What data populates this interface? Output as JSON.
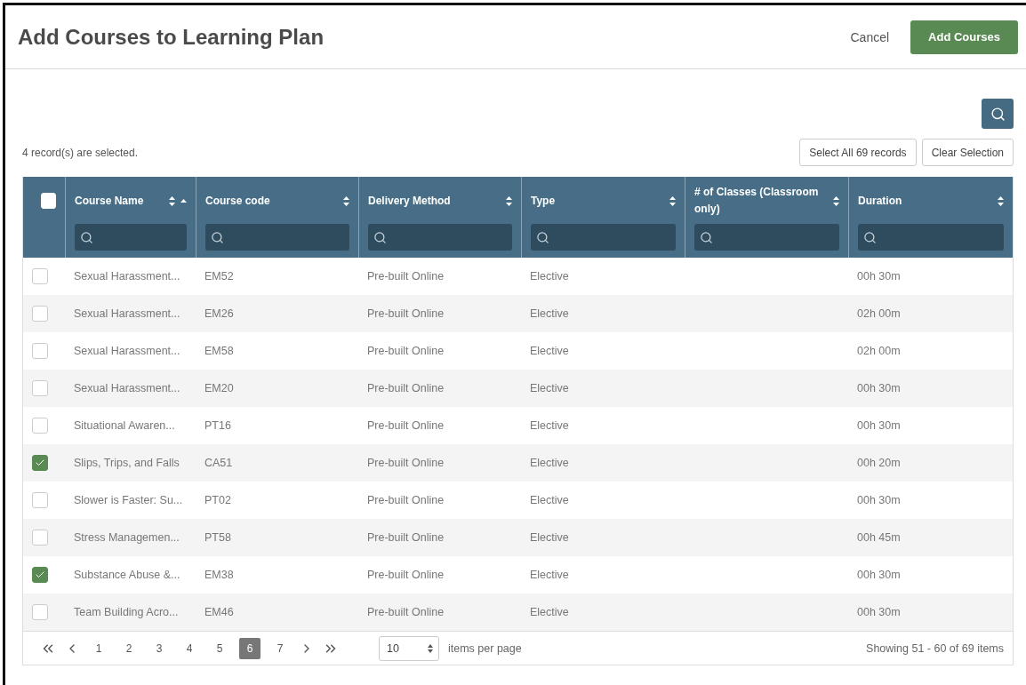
{
  "header": {
    "title": "Add Courses to Learning Plan",
    "cancel": "Cancel",
    "submit": "Add Courses"
  },
  "selection": {
    "summary": "4 record(s) are selected.",
    "select_all": "Select All 69 records",
    "clear": "Clear Selection"
  },
  "table": {
    "all_checked": false,
    "columns": [
      {
        "label": "Course Name",
        "sorted_asc": true
      },
      {
        "label": "Course code",
        "sorted_asc": false
      },
      {
        "label": "Delivery Method",
        "sorted_asc": false
      },
      {
        "label": "Type",
        "sorted_asc": false
      },
      {
        "label": "# of Classes (Classroom only)",
        "sorted_asc": false
      },
      {
        "label": "Duration",
        "sorted_asc": false
      }
    ],
    "rows": [
      {
        "checked": false,
        "cells": [
          "Sexual Harassment...",
          "EM52",
          "Pre-built Online",
          "Elective",
          "",
          "00h 30m"
        ]
      },
      {
        "checked": false,
        "cells": [
          "Sexual Harassment...",
          "EM26",
          "Pre-built Online",
          "Elective",
          "",
          "02h 00m"
        ]
      },
      {
        "checked": false,
        "cells": [
          "Sexual Harassment...",
          "EM58",
          "Pre-built Online",
          "Elective",
          "",
          "02h 00m"
        ]
      },
      {
        "checked": false,
        "cells": [
          "Sexual Harassment...",
          "EM20",
          "Pre-built Online",
          "Elective",
          "",
          "00h 30m"
        ]
      },
      {
        "checked": false,
        "cells": [
          "Situational Awaren...",
          "PT16",
          "Pre-built Online",
          "Elective",
          "",
          "00h 30m"
        ]
      },
      {
        "checked": true,
        "cells": [
          "Slips, Trips, and Falls",
          "CA51",
          "Pre-built Online",
          "Elective",
          "",
          "00h 20m"
        ]
      },
      {
        "checked": false,
        "cells": [
          "Slower is Faster: Su...",
          "PT02",
          "Pre-built Online",
          "Elective",
          "",
          "00h 30m"
        ]
      },
      {
        "checked": false,
        "cells": [
          "Stress Managemen...",
          "PT58",
          "Pre-built Online",
          "Elective",
          "",
          "00h 45m"
        ]
      },
      {
        "checked": true,
        "cells": [
          "Substance Abuse &...",
          "EM38",
          "Pre-built Online",
          "Elective",
          "",
          "00h 30m"
        ]
      },
      {
        "checked": false,
        "cells": [
          "Team Building Acro...",
          "EM46",
          "Pre-built Online",
          "Elective",
          "",
          "00h 30m"
        ]
      }
    ]
  },
  "pagination": {
    "pages": [
      {
        "label": "1",
        "selected": false
      },
      {
        "label": "2",
        "selected": false
      },
      {
        "label": "3",
        "selected": false
      },
      {
        "label": "4",
        "selected": false
      },
      {
        "label": "5",
        "selected": false
      },
      {
        "label": "6",
        "selected": true
      },
      {
        "label": "7",
        "selected": false
      }
    ],
    "page_size": "10",
    "page_size_label": "items per page",
    "summary": "Showing 51 - 60 of 69 items"
  }
}
